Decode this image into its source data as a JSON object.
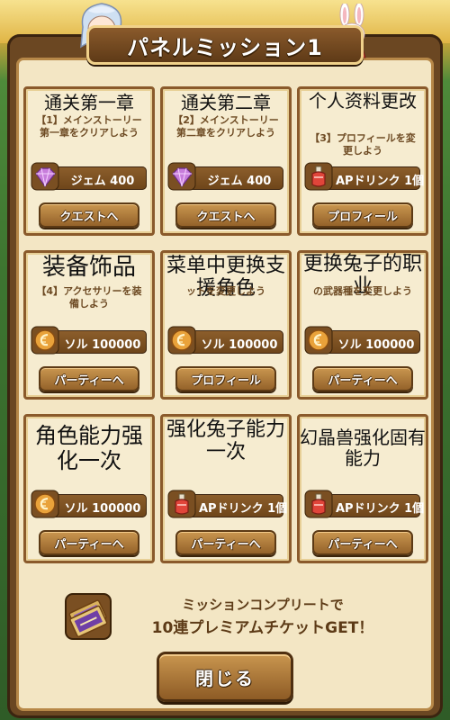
{
  "title": "パネルミッション1",
  "missions": [
    {
      "zh": "通关第一章",
      "jp": "【1】メインストーリー第一章をクリアしよう",
      "reward_icon": "gem-icon",
      "reward": "ジェム 400",
      "button": "クエストへ"
    },
    {
      "zh": "通关第二章",
      "jp": "【2】メインストーリー第二章をクリアしよう",
      "reward_icon": "gem-icon",
      "reward": "ジェム 400",
      "button": "クエストへ"
    },
    {
      "zh": "个人资料更改",
      "jp": "【3】プロフィールを変更しよう",
      "reward_icon": "ap-drink-icon",
      "reward": "APドリンク 1個",
      "button": "プロフィール"
    },
    {
      "zh": "装备饰品",
      "jp": "【4】アクセサリーを装備しよう",
      "reward_icon": "sol-coin-icon",
      "reward": "ソル 100000",
      "button": "パーティーへ"
    },
    {
      "zh": "菜单中更换支援角色",
      "jp": "ットを変更しよう",
      "reward_icon": "sol-coin-icon",
      "reward": "ソル 100000",
      "button": "プロフィール"
    },
    {
      "zh": "更换兔子的职业",
      "jp": "の武器種を変更しよう",
      "reward_icon": "sol-coin-icon",
      "reward": "ソル 100000",
      "button": "パーティーへ"
    },
    {
      "zh": "角色能力强化一次",
      "jp": "",
      "reward_icon": "sol-coin-icon",
      "reward": "ソル 100000",
      "button": "パーティーへ"
    },
    {
      "zh": "强化兔子能力一次",
      "jp": "",
      "reward_icon": "ap-drink-icon",
      "reward": "APドリンク 1個",
      "button": "パーティーへ"
    },
    {
      "zh": "幻晶兽强化固有能力",
      "jp": "",
      "reward_icon": "ap-drink-icon",
      "reward": "APドリンク 1個",
      "button": "パーティーへ"
    }
  ],
  "complete": {
    "line1": "ミッションコンプリートで",
    "line2": "10連プレミアムチケットGET！"
  },
  "close_label": "閉じる",
  "colors": {
    "panel": "#6b4722",
    "parchment": "#f3e6c4",
    "button": "#b07a3c",
    "reward_bar": "#7a4f22"
  }
}
